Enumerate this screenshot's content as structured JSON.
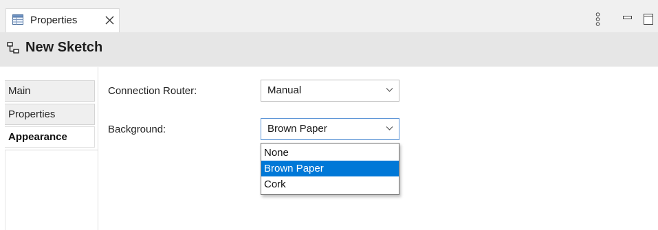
{
  "view_tab": {
    "label": "Properties",
    "icon": "properties-table-icon"
  },
  "title": {
    "text": "New Sketch",
    "icon": "sketch-icon"
  },
  "side_tabs": [
    {
      "label": "Main",
      "active": false
    },
    {
      "label": "Properties",
      "active": false
    },
    {
      "label": "Appearance",
      "active": true
    }
  ],
  "connection_router": {
    "label": "Connection Router:",
    "value": "Manual"
  },
  "background": {
    "label": "Background:",
    "value": "Brown Paper",
    "options": [
      "None",
      "Brown Paper",
      "Cork"
    ],
    "selected_option": "Brown Paper"
  },
  "colors": {
    "selection": "#0078d7",
    "focus_border": "#5b94d6"
  }
}
